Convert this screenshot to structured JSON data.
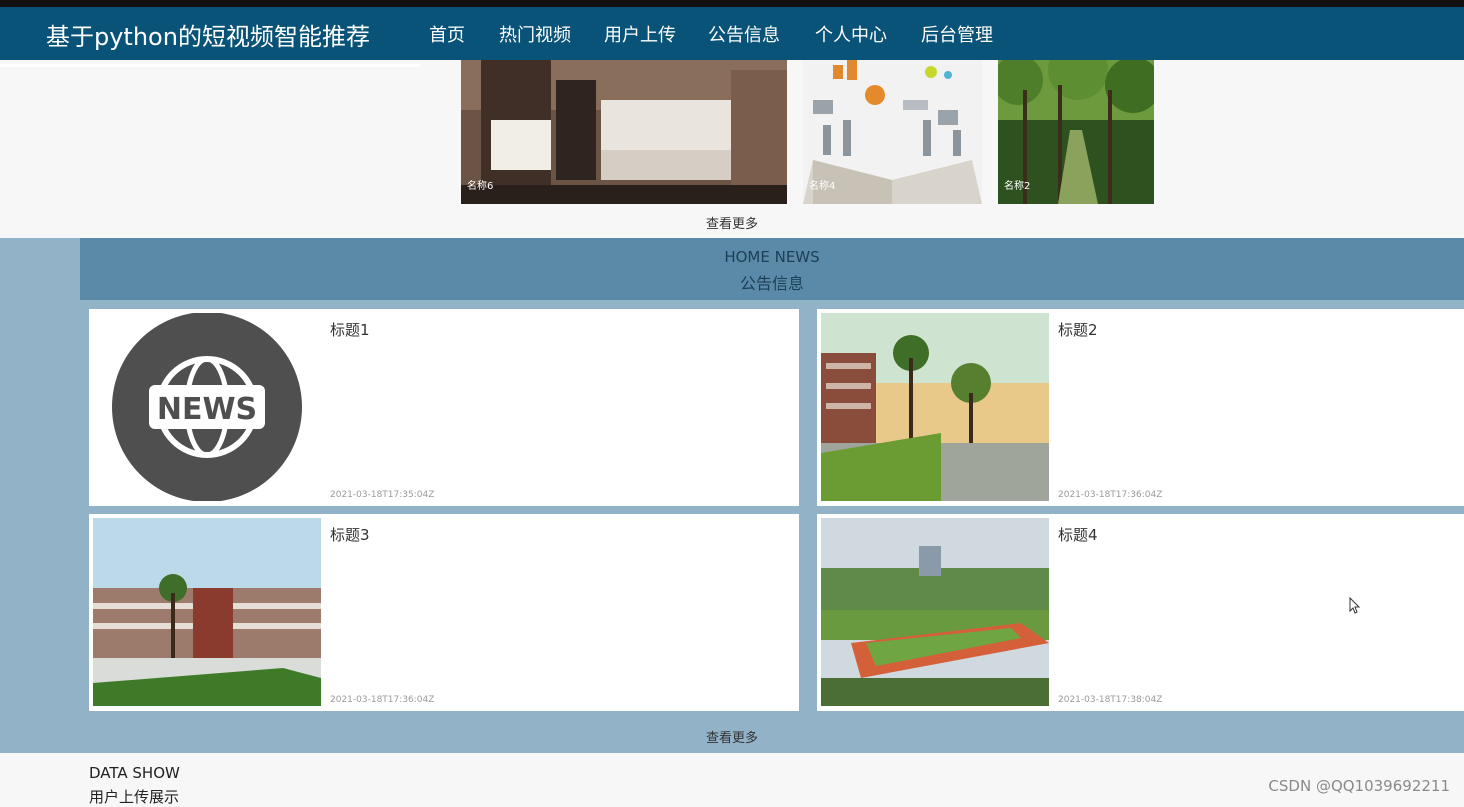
{
  "header": {
    "site_title": "基于python的短视频智能推荐",
    "nav": [
      "首页",
      "热门视频",
      "用户上传",
      "公告信息",
      "个人中心",
      "后台管理"
    ]
  },
  "videos": {
    "items": [
      {
        "caption": "名称6"
      },
      {
        "caption": "名称4"
      },
      {
        "caption": "名称2"
      }
    ],
    "more_label": "查看更多"
  },
  "news": {
    "heading_en": "HOME NEWS",
    "heading_cn": "公告信息",
    "items": [
      {
        "title": "标题1",
        "time": "2021-03-18T17:35:04Z"
      },
      {
        "title": "标题2",
        "time": "2021-03-18T17:36:04Z"
      },
      {
        "title": "标题3",
        "time": "2021-03-18T17:36:04Z"
      },
      {
        "title": "标题4",
        "time": "2021-03-18T17:38:04Z"
      }
    ],
    "more_label": "查看更多"
  },
  "data_show": {
    "heading_en": "DATA SHOW",
    "heading_cn": "用户上传展示"
  },
  "watermark": "CSDN @QQ1039692211",
  "colors": {
    "navbar": "#0a5378",
    "news_section": "#92b2c7",
    "news_header": "#5a8aa8"
  }
}
